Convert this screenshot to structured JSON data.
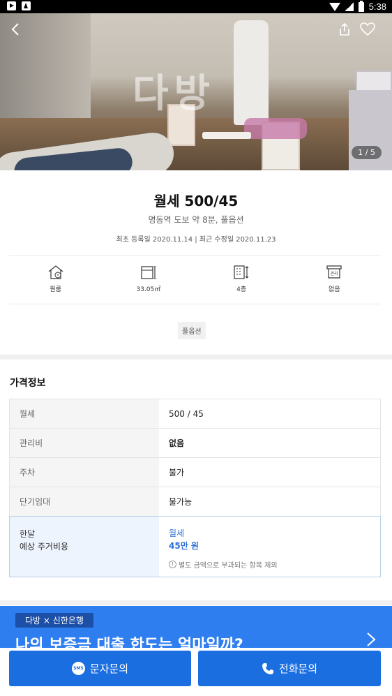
{
  "status_bar": {
    "time": "5:38"
  },
  "photo": {
    "counter": "1 / 5",
    "watermark": "다방"
  },
  "listing": {
    "title": "월세 500/45",
    "subtitle": "명동역 도보 약 8분, 풀옵션",
    "dates": "최초 등록일 2020.11.14 | 최근 수정일 2020.11.23"
  },
  "specs": [
    {
      "icon": "house-icon",
      "label": "원룸"
    },
    {
      "icon": "area-icon",
      "label": "33.05㎡"
    },
    {
      "icon": "floor-icon",
      "label": "4층"
    },
    {
      "icon": "management-icon",
      "label": "없음",
      "icon_text": "관리"
    }
  ],
  "tag": "풀옵션",
  "price_section": {
    "title": "가격정보",
    "rows": [
      {
        "key": "월세",
        "value": "500 / 45"
      },
      {
        "key": "관리비",
        "value": "없음"
      },
      {
        "key": "주차",
        "value": "불가"
      },
      {
        "key": "단기임대",
        "value": "불가능"
      }
    ],
    "monthly": {
      "key_line1": "한달",
      "key_line2": "예상 주거비용",
      "label": "월세",
      "amount": "45만 원",
      "note": "별도 금액으로 부과되는 항목 제외"
    }
  },
  "banner": {
    "badge": "다방 × 신한은행",
    "text": "나의 보증금 대출 한도는 얼마일까?"
  },
  "actions": {
    "sms_label": "문자문의",
    "sms_icon_text": "SMS",
    "call_label": "전화문의"
  },
  "colors": {
    "accent": "#1a6ee0",
    "banner": "#2f7ef0",
    "highlight_bg": "#eef4fd"
  }
}
